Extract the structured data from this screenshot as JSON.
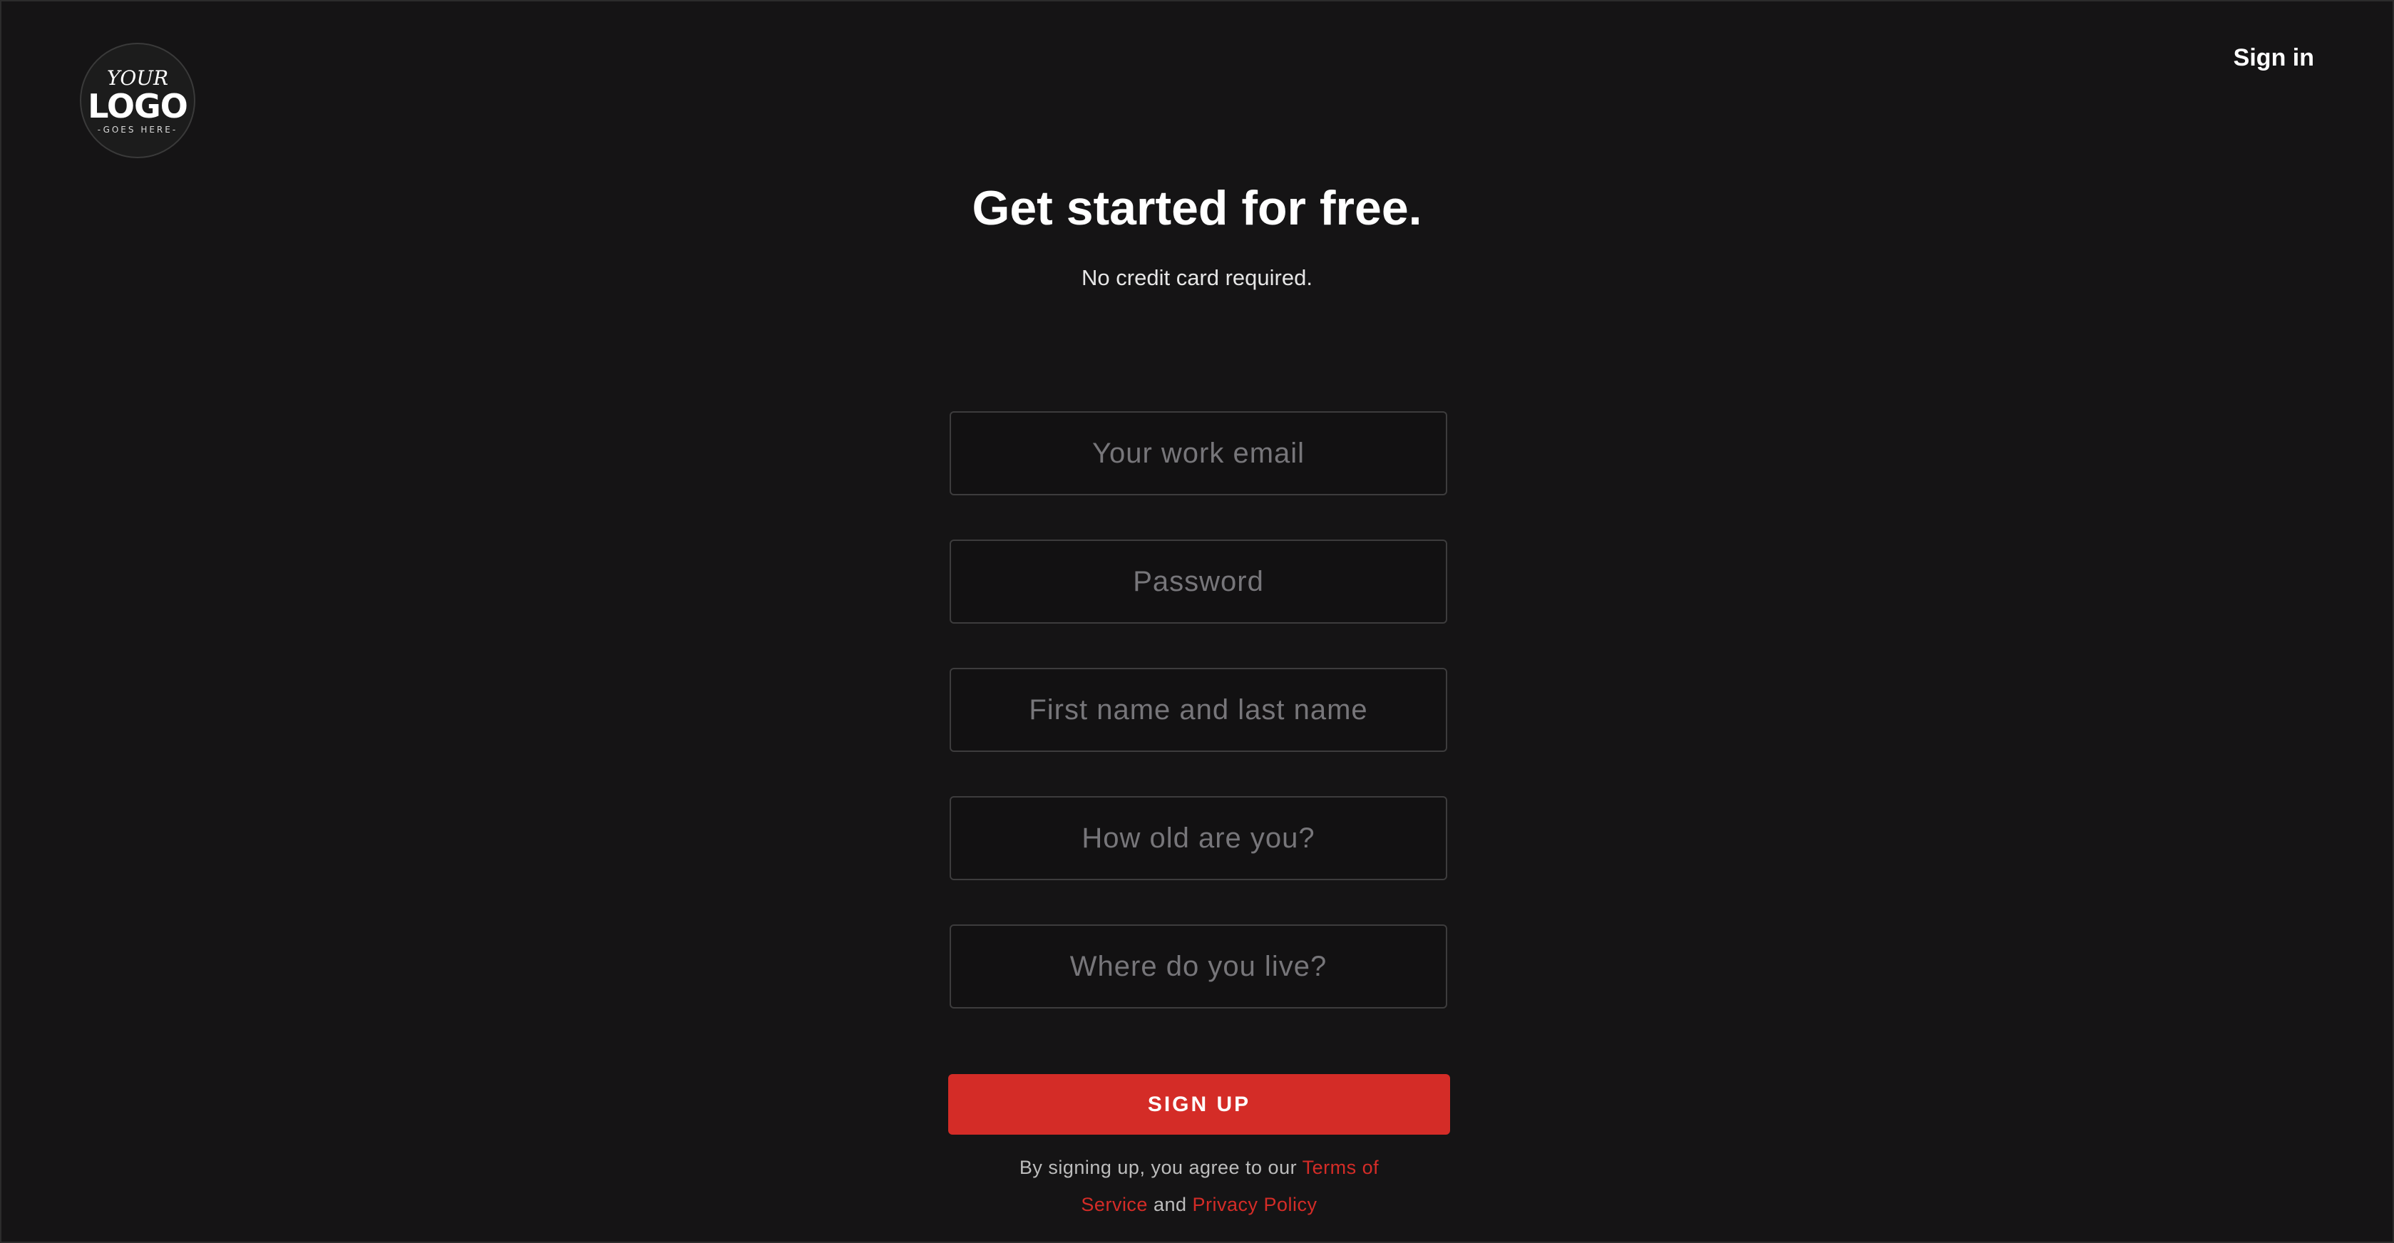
{
  "logo": {
    "top": "YOUR",
    "main": "LOGO",
    "bottom": "-GOES HERE-"
  },
  "header": {
    "sign_in_label": "Sign in"
  },
  "hero": {
    "title": "Get started for free.",
    "subtitle": "No credit card required."
  },
  "form": {
    "email_placeholder": "Your work email",
    "email_value": "",
    "password_placeholder": "Password",
    "password_value": "",
    "name_placeholder": "First name and last name",
    "name_value": "",
    "age_placeholder": "How old are you?",
    "age_value": "",
    "location_placeholder": "Where do you live?",
    "location_value": "",
    "submit_label": "SIGN UP"
  },
  "legal": {
    "prefix": "By signing up, you agree to our ",
    "terms_label": "Terms of Service",
    "conjunction": " and ",
    "privacy_label": "Privacy Policy"
  },
  "colors": {
    "background": "#151415",
    "accent": "#d42c27",
    "field_border": "#3d3c3d",
    "placeholder": "#77767a"
  }
}
